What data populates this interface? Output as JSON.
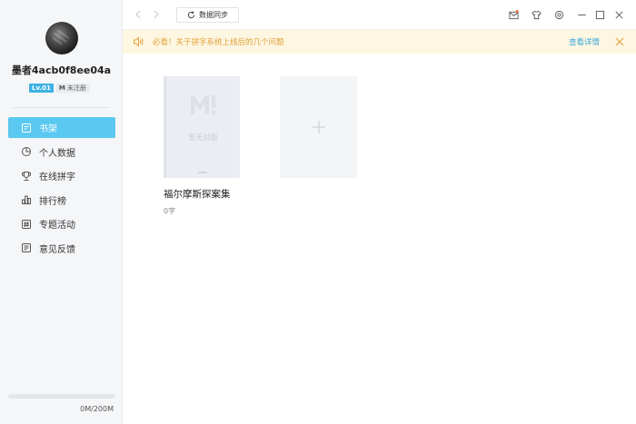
{
  "user": {
    "name": "墨者4acb0f8ee04a",
    "level": "Lv.01",
    "status": "未注册",
    "status_mark": "M"
  },
  "nav": {
    "items": [
      {
        "label": "书架",
        "icon": "book-icon",
        "active": true
      },
      {
        "label": "个人数据",
        "icon": "chart-icon",
        "active": false
      },
      {
        "label": "在线拼字",
        "icon": "trophy-icon",
        "active": false
      },
      {
        "label": "排行榜",
        "icon": "ranking-icon",
        "active": false
      },
      {
        "label": "专题活动",
        "icon": "hashtag-icon",
        "active": false
      },
      {
        "label": "意见反馈",
        "icon": "feedback-icon",
        "active": false
      }
    ]
  },
  "storage": {
    "text": "0M/200M",
    "used_fraction": 0
  },
  "toolbar": {
    "sync_label": "数据同步"
  },
  "notice": {
    "text": "必看！关于拼字系统上线后的几个问题",
    "link": "查看详情",
    "text_color": "#e2a13b",
    "link_color": "#3aa9dc"
  },
  "shelf": {
    "books": [
      {
        "title": "福尔摩斯探案集",
        "word_count": "0字",
        "cover_text": "暂无封面",
        "cover_logo": "M!"
      }
    ]
  },
  "colors": {
    "accent": "#5ac8f0",
    "level_badge": "#3cb2e4",
    "notification_dot": "#f26b3a"
  }
}
